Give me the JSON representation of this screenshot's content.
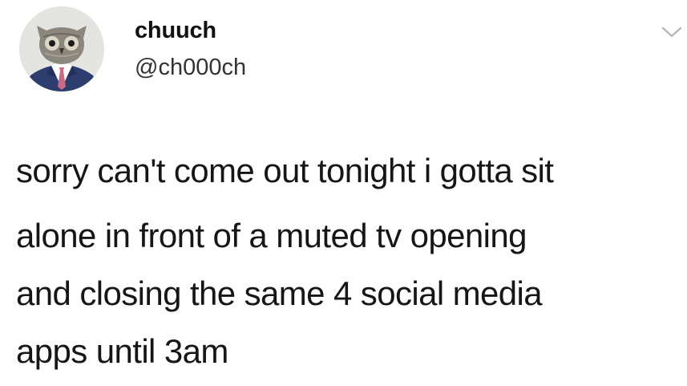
{
  "tweet": {
    "author": {
      "display_name": "chuuch",
      "handle": "@ch000ch",
      "avatar_icon": "owl-in-suit-avatar"
    },
    "menu_icon": "chevron-down-icon",
    "text_lines": [
      "sorry can't come out tonight i gotta sit",
      "alone in front of a muted tv opening",
      "and closing the same 4 social media",
      "apps until 3am"
    ]
  },
  "colors": {
    "background": "#ffffff",
    "text": "#161616",
    "handle": "#333333",
    "chevron": "#b3b8bd",
    "suit": "#2c3d6e"
  }
}
